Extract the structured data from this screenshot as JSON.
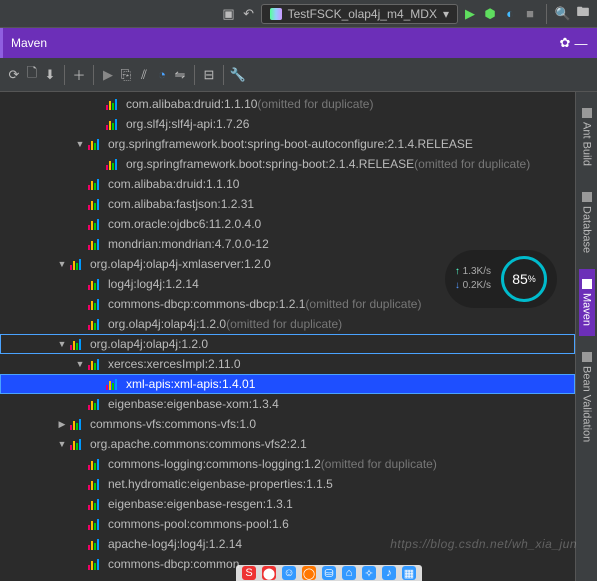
{
  "top": {
    "run_config": "TestFSCK_olap4j_m4_MDX"
  },
  "panel": {
    "title": "Maven"
  },
  "right_tabs": [
    {
      "id": "antbuild",
      "label": "Ant Build",
      "active": false
    },
    {
      "id": "database",
      "label": "Database",
      "active": false
    },
    {
      "id": "maven",
      "label": "Maven",
      "active": true
    },
    {
      "id": "beanval",
      "label": "Bean Validation",
      "active": false
    }
  ],
  "tree": [
    {
      "d": 4,
      "a": "",
      "t": "com.alibaba:druid:1.1.10",
      "dim": " (omitted for duplicate)"
    },
    {
      "d": 4,
      "a": "",
      "t": "org.slf4j:slf4j-api:1.7.26"
    },
    {
      "d": 3,
      "a": "down",
      "t": "org.springframework.boot:spring-boot-autoconfigure:2.1.4.RELEASE"
    },
    {
      "d": 4,
      "a": "",
      "t": "org.springframework.boot:spring-boot:2.1.4.RELEASE",
      "dim": " (omitted for duplicate)"
    },
    {
      "d": 3,
      "a": "",
      "t": "com.alibaba:druid:1.1.10"
    },
    {
      "d": 3,
      "a": "",
      "t": "com.alibaba:fastjson:1.2.31"
    },
    {
      "d": 3,
      "a": "",
      "t": "com.oracle:ojdbc6:11.2.0.4.0"
    },
    {
      "d": 3,
      "a": "",
      "t": "mondrian:mondrian:4.7.0.0-12"
    },
    {
      "d": 2,
      "a": "down",
      "t": "org.olap4j:olap4j-xmlaserver:1.2.0"
    },
    {
      "d": 3,
      "a": "",
      "t": "log4j:log4j:1.2.14"
    },
    {
      "d": 3,
      "a": "",
      "t": "commons-dbcp:commons-dbcp:1.2.1",
      "dim": " (omitted for duplicate)"
    },
    {
      "d": 3,
      "a": "",
      "t": "org.olap4j:olap4j:1.2.0",
      "dim": " (omitted for duplicate)"
    },
    {
      "d": 2,
      "a": "down",
      "t": "org.olap4j:olap4j:1.2.0",
      "box": true
    },
    {
      "d": 3,
      "a": "down",
      "t": "xerces:xercesImpl:2.11.0"
    },
    {
      "d": 4,
      "a": "",
      "t": "xml-apis:xml-apis:1.4.01",
      "sel": true,
      "box": true
    },
    {
      "d": 3,
      "a": "",
      "t": "eigenbase:eigenbase-xom:1.3.4"
    },
    {
      "d": 2,
      "a": "right",
      "t": "commons-vfs:commons-vfs:1.0"
    },
    {
      "d": 2,
      "a": "down",
      "t": "org.apache.commons:commons-vfs2:2.1"
    },
    {
      "d": 3,
      "a": "",
      "t": "commons-logging:commons-logging:1.2",
      "dim": " (omitted for duplicate)"
    },
    {
      "d": 3,
      "a": "",
      "t": "net.hydromatic:eigenbase-properties:1.1.5"
    },
    {
      "d": 3,
      "a": "",
      "t": "eigenbase:eigenbase-resgen:1.3.1"
    },
    {
      "d": 3,
      "a": "",
      "t": "commons-pool:commons-pool:1.6"
    },
    {
      "d": 3,
      "a": "",
      "t": "apache-log4j:log4j:1.2.14"
    },
    {
      "d": 3,
      "a": "",
      "t": "commons-dbcp:common"
    }
  ],
  "net": {
    "up": "1.3",
    "down": "0.2",
    "unit": "K/s",
    "pct": "85"
  },
  "watermark": "https://blog.csdn.net/wh_xia_jun",
  "dock": [
    {
      "c": "#e33",
      "t": "S"
    },
    {
      "c": "#e33",
      "t": "⬤"
    },
    {
      "c": "#39f",
      "t": "☺"
    },
    {
      "c": "#f70",
      "t": "◯"
    },
    {
      "c": "#39f",
      "t": "⛁"
    },
    {
      "c": "#39f",
      "t": "⌂"
    },
    {
      "c": "#39f",
      "t": "✧"
    },
    {
      "c": "#39f",
      "t": "♪"
    },
    {
      "c": "#39f",
      "t": "▦"
    }
  ]
}
